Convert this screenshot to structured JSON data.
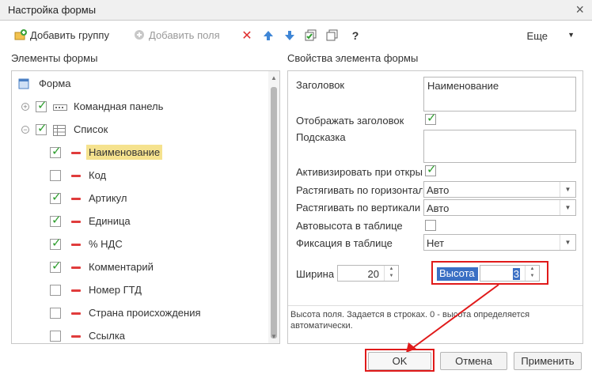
{
  "window": {
    "title": "Настройка формы",
    "close_symbol": "×"
  },
  "toolbar": {
    "add_group_label": "Добавить группу",
    "add_field_label": "Добавить поля",
    "more_label": "Еще",
    "help_symbol": "?"
  },
  "left_panel": {
    "title": "Элементы формы",
    "rows": [
      {
        "label": "Форма",
        "level": 0,
        "checked": null,
        "icon": "form-icon",
        "expander": null,
        "selected": false
      },
      {
        "label": "Командная панель",
        "level": 1,
        "checked": true,
        "icon": "command-panel-icon",
        "expander": "+",
        "selected": false
      },
      {
        "label": "Список",
        "level": 1,
        "checked": true,
        "icon": "table-icon",
        "expander": "−",
        "selected": false
      },
      {
        "label": "Наименование",
        "level": 2,
        "checked": true,
        "icon": "field-icon",
        "expander": null,
        "selected": true
      },
      {
        "label": "Код",
        "level": 2,
        "checked": false,
        "icon": "field-icon",
        "expander": null,
        "selected": false
      },
      {
        "label": "Артикул",
        "level": 2,
        "checked": true,
        "icon": "field-icon",
        "expander": null,
        "selected": false
      },
      {
        "label": "Единица",
        "level": 2,
        "checked": true,
        "icon": "field-icon",
        "expander": null,
        "selected": false
      },
      {
        "label": "% НДС",
        "level": 2,
        "checked": true,
        "icon": "field-icon",
        "expander": null,
        "selected": false
      },
      {
        "label": "Комментарий",
        "level": 2,
        "checked": true,
        "icon": "field-icon",
        "expander": null,
        "selected": false
      },
      {
        "label": "Номер ГТД",
        "level": 2,
        "checked": false,
        "icon": "field-icon",
        "expander": null,
        "selected": false
      },
      {
        "label": "Страна происхождения",
        "level": 2,
        "checked": false,
        "icon": "field-icon",
        "expander": null,
        "selected": false
      },
      {
        "label": "Ссылка",
        "level": 2,
        "checked": false,
        "icon": "field-icon",
        "expander": null,
        "selected": false
      }
    ]
  },
  "right_panel": {
    "title": "Свойства элемента формы",
    "header_label": "Заголовок",
    "header_value": "Наименование",
    "show_header_label": "Отображать заголовок",
    "show_header_checked": true,
    "tooltip_label": "Подсказка",
    "tooltip_value": "",
    "activate_label": "Активизировать при откры",
    "activate_checked": true,
    "stretch_h_label": "Растягивать по горизонтал",
    "stretch_h_value": "Авто",
    "stretch_v_label": "Растягивать по вертикали",
    "stretch_v_value": "Авто",
    "autoheight_label": "Автовысота в таблице",
    "autoheight_checked": false,
    "fix_label": "Фиксация в таблице",
    "fix_value": "Нет",
    "width_label": "Ширина",
    "width_value": "20",
    "height_label": "Высота",
    "height_value": "3",
    "hint": "Высота поля. Задается в строках. 0 - высота определяется автоматически."
  },
  "buttons": {
    "ok": "OK",
    "cancel": "Отмена",
    "apply": "Применить"
  },
  "colors": {
    "check": "#2e9e2e",
    "highlight_red": "#e01a1a",
    "selected_row": "#f5e28e",
    "height_label_bg": "#3a6fc4"
  }
}
